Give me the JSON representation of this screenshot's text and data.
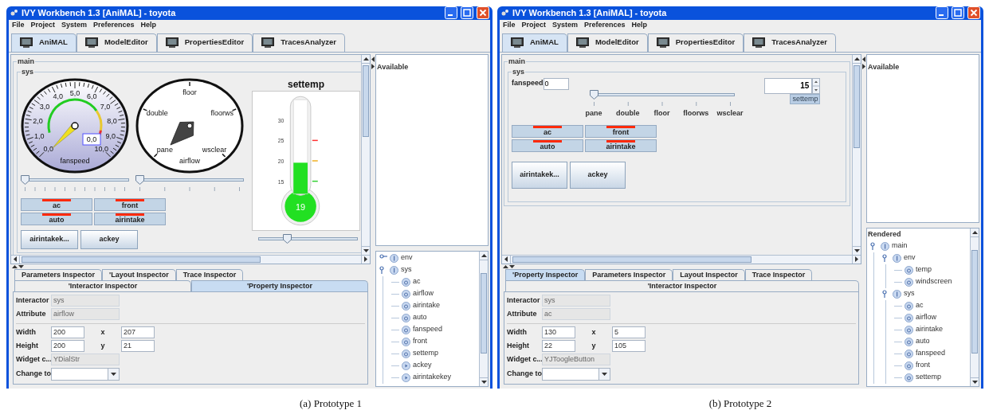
{
  "figures": [
    {
      "caption": "(a) Prototype 1",
      "window": {
        "title": "IVY Workbench 1.3 [AniMAL] - toyota"
      },
      "menu": [
        "File",
        "Project",
        "System",
        "Preferences",
        "Help"
      ],
      "app_tabs": [
        {
          "label": "AniMAL",
          "selected": true
        },
        {
          "label": "ModelEditor",
          "selected": false
        },
        {
          "label": "PropertiesEditor",
          "selected": false
        },
        {
          "label": "TracesAnalyzer",
          "selected": false
        }
      ],
      "canvas": {
        "kind": "gauges",
        "groups": [
          "main",
          "sys"
        ],
        "fanspeed_dial": {
          "labels": [
            "0,0",
            "1,0",
            "2,0",
            "3,0",
            "4,0",
            "5,0",
            "6,0",
            "7,0",
            "8,0",
            "9,0",
            "10,0"
          ],
          "value": "0,0",
          "title": "fanspeed"
        },
        "fanspeed_slider": {
          "level": 0
        },
        "airflow_dial": {
          "labels": [
            "pane",
            "double",
            "floor",
            "floorws",
            "wsclear"
          ],
          "title": "airflow"
        },
        "airflow_slider": {
          "level": 0
        },
        "toggles": [
          {
            "label": "ac",
            "on": false
          },
          {
            "label": "front",
            "on": false
          },
          {
            "label": "auto",
            "on": false
          },
          {
            "label": "airintake",
            "on": false
          }
        ],
        "buttons": [
          "airintakek...",
          "ackey"
        ],
        "thermometer": {
          "title": "settemp",
          "ticks": [
            "30",
            "25",
            "20",
            "15"
          ],
          "value": "19",
          "level": 0.33
        },
        "settemp_slider": {
          "level": 0.3
        }
      },
      "available": {
        "title": "Available"
      },
      "tree": {
        "nodes": [
          {
            "label": "env",
            "kind": "interactor",
            "expanded": false
          },
          {
            "label": "sys",
            "kind": "interactor",
            "expanded": true,
            "children": [
              {
                "label": "ac",
                "kind": "attribute"
              },
              {
                "label": "airflow",
                "kind": "attribute"
              },
              {
                "label": "airintake",
                "kind": "attribute"
              },
              {
                "label": "auto",
                "kind": "attribute"
              },
              {
                "label": "fanspeed",
                "kind": "attribute"
              },
              {
                "label": "front",
                "kind": "attribute"
              },
              {
                "label": "settemp",
                "kind": "attribute"
              },
              {
                "label": "ackey",
                "kind": "action"
              },
              {
                "label": "airintakekey",
                "kind": "action"
              }
            ]
          }
        ]
      },
      "inspector": {
        "tab_rows": [
          [
            {
              "label": "Parameters Inspector",
              "selected": false
            },
            {
              "label": "'Layout Inspector",
              "selected": false
            },
            {
              "label": "Trace Inspector",
              "selected": false
            }
          ],
          [
            {
              "label": "'Interactor Inspector",
              "selected": false
            },
            {
              "label": "'Property Inspector",
              "selected": true
            }
          ]
        ],
        "readonly": [
          {
            "label": "Interactor",
            "value": "sys"
          },
          {
            "label": "Attribute",
            "value": "airflow"
          }
        ],
        "geometry": [
          {
            "label": "Width",
            "value": "200",
            "coord_label": "x",
            "coord_value": "207"
          },
          {
            "label": "Height",
            "value": "200",
            "coord_label": "y",
            "coord_value": "21"
          }
        ],
        "widget_class": {
          "label": "Widget c...",
          "value": "YDialStr"
        },
        "change_to": {
          "label": "Change to"
        }
      }
    },
    {
      "caption": "(b) Prototype 2",
      "window": {
        "title": "IVY Workbench 1.3 [AniMAL] - toyota"
      },
      "menu": [
        "File",
        "Project",
        "System",
        "Preferences",
        "Help"
      ],
      "app_tabs": [
        {
          "label": "AniMAL",
          "selected": true
        },
        {
          "label": "ModelEditor",
          "selected": false
        },
        {
          "label": "PropertiesEditor",
          "selected": false
        },
        {
          "label": "TracesAnalyzer",
          "selected": false
        }
      ],
      "canvas": {
        "kind": "controls",
        "groups": [
          "main",
          "sys"
        ],
        "fanspeed_field": {
          "label": "fanspeed",
          "value": "0"
        },
        "airflow_slider": {
          "level": 0,
          "labels": [
            "pane",
            "double",
            "floor",
            "floorws",
            "wsclear"
          ]
        },
        "settemp_spinner": {
          "value": "15",
          "label": "settemp"
        },
        "toggles": [
          {
            "label": "ac",
            "on": false
          },
          {
            "label": "front",
            "on": false
          },
          {
            "label": "auto",
            "on": false
          },
          {
            "label": "airintake",
            "on": false
          }
        ],
        "buttons": [
          "airintakek...",
          "ackey"
        ]
      },
      "available": {
        "title": "Available"
      },
      "tree": {
        "title": "Rendered",
        "nodes": [
          {
            "label": "main",
            "kind": "interactor",
            "expanded": true,
            "children": [
              {
                "label": "env",
                "kind": "interactor",
                "expanded": true,
                "children": [
                  {
                    "label": "temp",
                    "kind": "attribute"
                  },
                  {
                    "label": "windscreen",
                    "kind": "attribute"
                  }
                ]
              },
              {
                "label": "sys",
                "kind": "interactor",
                "expanded": true,
                "children": [
                  {
                    "label": "ac",
                    "kind": "attribute"
                  },
                  {
                    "label": "airflow",
                    "kind": "attribute"
                  },
                  {
                    "label": "airintake",
                    "kind": "attribute"
                  },
                  {
                    "label": "auto",
                    "kind": "attribute"
                  },
                  {
                    "label": "fanspeed",
                    "kind": "attribute"
                  },
                  {
                    "label": "front",
                    "kind": "attribute"
                  },
                  {
                    "label": "settemp",
                    "kind": "attribute"
                  }
                ]
              }
            ]
          }
        ]
      },
      "inspector": {
        "tab_rows": [
          [
            {
              "label": "'Property Inspector",
              "selected": true
            },
            {
              "label": "Parameters Inspector",
              "selected": false
            },
            {
              "label": "Layout Inspector",
              "selected": false
            },
            {
              "label": "Trace Inspector",
              "selected": false
            }
          ],
          [
            {
              "label": "'Interactor Inspector",
              "selected": false
            }
          ]
        ],
        "readonly": [
          {
            "label": "Interactor",
            "value": "sys"
          },
          {
            "label": "Attribute",
            "value": "ac"
          }
        ],
        "geometry": [
          {
            "label": "Width",
            "value": "130",
            "coord_label": "x",
            "coord_value": "5"
          },
          {
            "label": "Height",
            "value": "22",
            "coord_label": "y",
            "coord_value": "105"
          }
        ],
        "widget_class": {
          "label": "Widget c...",
          "value": "YJToogleButton"
        },
        "change_to": {
          "label": "Change to"
        }
      }
    }
  ]
}
